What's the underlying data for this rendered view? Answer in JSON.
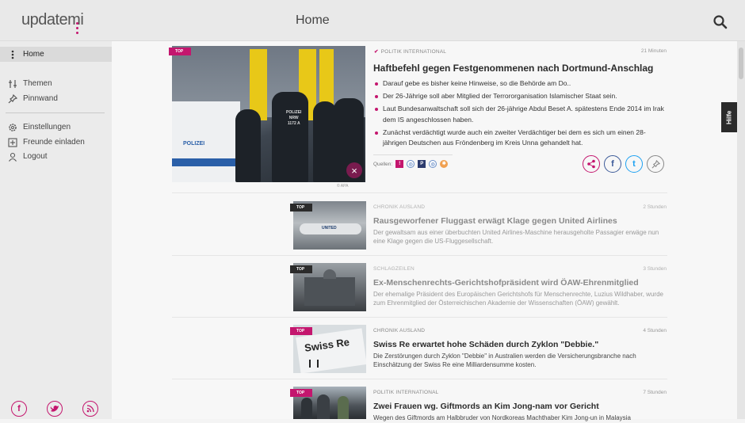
{
  "header": {
    "logo_text": "updatemi",
    "title": "Home",
    "search_icon": "search-icon"
  },
  "sidebar": {
    "items": [
      {
        "label": "Home",
        "icon": "home-dots-icon",
        "active": true
      },
      {
        "label": "Themen",
        "icon": "sliders-icon"
      },
      {
        "label": "Pinnwand",
        "icon": "pin-icon"
      },
      {
        "label": "Einstellungen",
        "icon": "gear-icon"
      },
      {
        "label": "Freunde einladen",
        "icon": "plus-box-icon"
      },
      {
        "label": "Logout",
        "icon": "user-icon"
      }
    ],
    "social": [
      "facebook-icon",
      "twitter-icon",
      "rss-icon"
    ]
  },
  "help_tab": "Hilfe",
  "featured": {
    "badge": "TOP",
    "category": "POLITIK INTERNATIONAL",
    "time": "21 Minuten",
    "title": "Haftbefehl gegen Festgenommenen nach Dortmund-Anschlag",
    "bullets": [
      "Darauf gebe es bisher keine Hinweise, so die Behörde am Do..",
      "Der 26-Jährige soll aber Mitglied der Terrororganisation Islamischer Staat sein.",
      "Laut Bundesanwaltschaft soll sich der 26-jährige Abdul Beset A. spätestens Ende 2014 im Irak dem IS angeschlossen haben.",
      "Zunächst verdächtigt wurde auch ein zweiter Verdächtiger bei dem es sich um einen 28-jährigen Deutschen aus Fröndenberg im Kreis Unna gehandelt hat."
    ],
    "sources_label": "Quellen:",
    "image_credit": "© APA",
    "van_text": "POLIZEI",
    "vest_text": "POLIZEI",
    "vest_code_1": "NRW",
    "vest_code_2": "1172 A"
  },
  "articles": [
    {
      "badge": "TOP",
      "category": "CHRONIK AUSLAND",
      "time": "2 Stunden",
      "title": "Rausgeworfener Fluggast erwägt Klage gegen United Airlines",
      "desc": "Der gewaltsam aus einer überbuchten United Airlines-Maschine herausgeholte Passagier erwäge nun eine Klage gegen die US-Fluggesellschaft.",
      "thumb_text": "UNITED",
      "dim": true
    },
    {
      "badge": "TOP",
      "category": "SCHLAGZEILEN",
      "time": "3 Stunden",
      "title": "Ex-Menschenrechts-Gerichtshofpräsident wird ÖAW-Ehrenmitglied",
      "desc": "Der ehemalige Präsident des Europäischen Gerichtshofs für Menschenrechte, Luzius Wildhaber, wurde zum Ehrenmitglied der Österreichischen Akademie der Wissenschaften (ÖAW) gewählt.",
      "dim": true
    },
    {
      "badge": "TOP",
      "category": "CHRONIK AUSLAND",
      "time": "4 Stunden",
      "title": "Swiss Re erwartet hohe Schäden durch Zyklon \"Debbie.\"",
      "desc": "Die Zerstörungen durch Zyklon \"Debbie\" in Australien werden die Versicherungsbranche nach Einschätzung der Swiss Re eine Milliardensumme kosten.",
      "thumb_text": "Swiss Re",
      "dim": false
    },
    {
      "badge": "TOP",
      "category": "POLITIK INTERNATIONAL",
      "time": "7 Stunden",
      "title": "Zwei Frauen wg. Giftmords an Kim Jong-nam vor Gericht",
      "desc": "Wegen des Giftmords am Halbbruder von Nordkoreas Machthaber Kim Jong-un in Malaysia",
      "dim": false
    }
  ],
  "colors": {
    "accent": "#c4166e",
    "sidebar_bg": "#ebebeb",
    "topbar_bg": "#e9e9e9"
  }
}
